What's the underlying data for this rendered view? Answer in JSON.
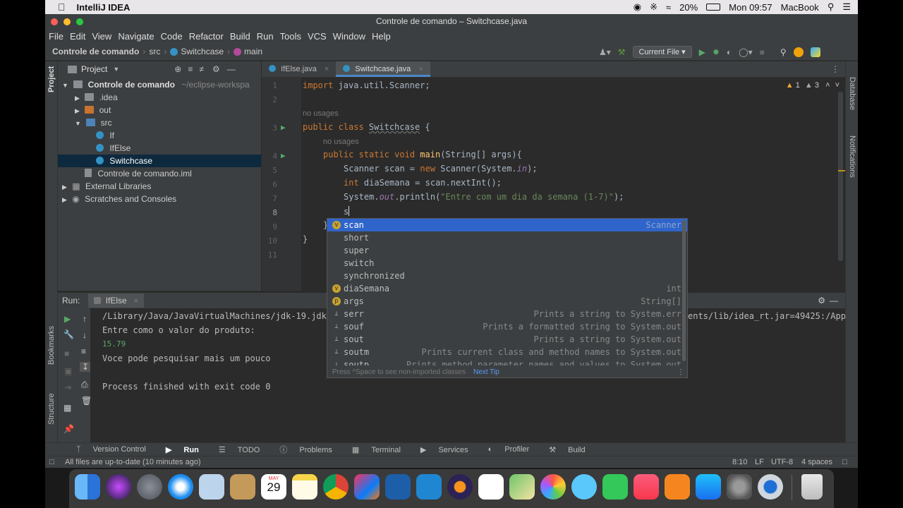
{
  "mac": {
    "app": "IntelliJ IDEA",
    "battery": "20%",
    "clock": "Mon 09:57",
    "host": "MacBook"
  },
  "window": {
    "title": "Controle de comando – Switchcase.java"
  },
  "menu": [
    "File",
    "Edit",
    "View",
    "Navigate",
    "Code",
    "Refactor",
    "Build",
    "Run",
    "Tools",
    "VCS",
    "Window",
    "Help"
  ],
  "breadcrumb": {
    "project": "Controle de comando",
    "src": "src",
    "file": "Switchcase",
    "method": "main"
  },
  "run_config": "Current File",
  "project_panel": {
    "title": "Project",
    "root": "Controle de comando",
    "root_path": "~/eclipse-workspa",
    "items": [
      {
        "label": ".idea"
      },
      {
        "label": "out"
      },
      {
        "label": "src"
      },
      {
        "label": "If"
      },
      {
        "label": "IfElse"
      },
      {
        "label": "Switchcase"
      },
      {
        "label": "Controle de comando.iml"
      },
      {
        "label": "External Libraries"
      },
      {
        "label": "Scratches and Consoles"
      }
    ]
  },
  "tabs": [
    {
      "label": "IfElse.java"
    },
    {
      "label": "Switchcase.java"
    }
  ],
  "inspections": {
    "warnings": "1",
    "weak": "3"
  },
  "editor": {
    "line_numbers": [
      "1",
      "2",
      "3",
      "4",
      "5",
      "6",
      "7",
      "8",
      "9",
      "10",
      "11"
    ],
    "hint_usages": "no usages",
    "lines": {
      "l1_kw": "import",
      "l1_rest": " java.util.Scanner;",
      "l3_kw": "public class ",
      "l3_name": "Switchcase",
      "l3_rest": " {",
      "l4_kw": "public static void ",
      "l4_name": "main",
      "l4_rest": "(String[] args){",
      "l5_a": "Scanner scan = ",
      "l5_kw": "new",
      "l5_b": " Scanner(System.",
      "l5_fld": "in",
      "l5_c": ");",
      "l6_kw": "int",
      "l6_rest": " diaSemana = scan.nextInt();",
      "l7_a": "System.",
      "l7_fld": "out",
      "l7_b": ".println(",
      "l7_str": "\"Entre com um dia da semana (1-7)\"",
      "l7_c": ");",
      "l8": "s",
      "l9": "}",
      "l10": "}"
    }
  },
  "completion": {
    "items": [
      {
        "label": "scan",
        "type": "Scanner"
      },
      {
        "label": "short",
        "type": ""
      },
      {
        "label": "super",
        "type": ""
      },
      {
        "label": "switch",
        "type": ""
      },
      {
        "label": "synchronized",
        "type": ""
      },
      {
        "label": "diaSemana",
        "type": "int"
      },
      {
        "label": "args",
        "type": "String[]"
      },
      {
        "label": "serr",
        "type": "Prints a string to System.err"
      },
      {
        "label": "souf",
        "type": "Prints a formatted string to System.out"
      },
      {
        "label": "sout",
        "type": "Prints a string to System.out"
      },
      {
        "label": "soutm",
        "type": "Prints current class and method names to System.out"
      },
      {
        "label": "soutp",
        "type": "Prints method parameter names and values to System.out"
      }
    ],
    "footer": "Press ^Space to see non-imported classes",
    "next_tip": "Next Tip"
  },
  "run": {
    "label": "Run:",
    "tab": "IfElse",
    "lines": [
      "/Library/Java/JavaVirtualMachines/jdk-19.jdk",
      "Entre como o valor do produto:",
      "15.79",
      "Voce pode pesquisar mais um pouco",
      "",
      "Process finished with exit code 0"
    ],
    "cmd_tail": "ents/lib/idea_rt.jar=49425:/App"
  },
  "tool_tabs": [
    "Version Control",
    "Run",
    "TODO",
    "Problems",
    "Terminal",
    "Services",
    "Profiler",
    "Build"
  ],
  "side_left": [
    "Project",
    "Bookmarks",
    "Structure"
  ],
  "side_right": [
    "Database",
    "Notifications"
  ],
  "status": {
    "message": "All files are up-to-date (10 minutes ago)",
    "pos": "8:10",
    "lf": "LF",
    "enc": "UTF-8",
    "indent": "4 spaces"
  },
  "dock_date": {
    "month": "MAY",
    "day": "29"
  },
  "colors": {
    "accent": "#2f65ca",
    "selection": "#0d293e",
    "keyword": "#cc7832",
    "string": "#6a8759"
  }
}
